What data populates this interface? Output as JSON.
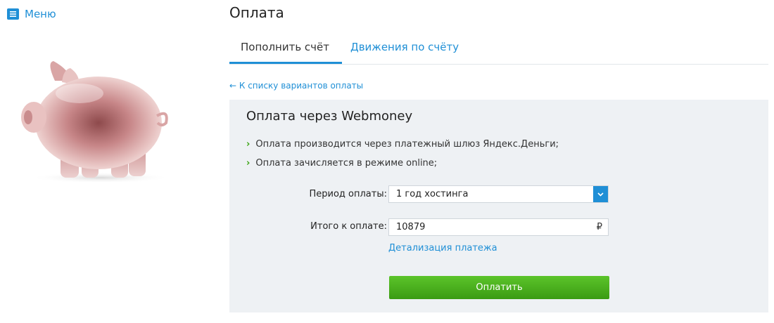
{
  "sidebar": {
    "menu_label": "Меню",
    "menu_icon": "hamburger-icon"
  },
  "header": {
    "title": "Оплата"
  },
  "tabs": [
    {
      "label": "Пополнить счёт",
      "active": true
    },
    {
      "label": "Движения по счёту",
      "active": false
    }
  ],
  "back_link": "← К списку вариантов оплаты",
  "panel": {
    "title": "Оплата через Webmoney",
    "bullets": [
      "Оплата производится через платежный шлюз Яндекс.Деньги;",
      "Оплата зачисляется в режиме online;"
    ],
    "period_label": "Период оплаты:",
    "period_value": "1 год хостинга",
    "total_label": "Итого к оплате:",
    "total_value": "10879",
    "currency": "₽",
    "details_link": "Детализация платежа",
    "pay_button": "Оплатить"
  },
  "colors": {
    "accent": "#1f8fd6",
    "button_green": "#4bb21e",
    "panel_bg": "#eef1f4",
    "bullet_green": "#3aa412"
  }
}
